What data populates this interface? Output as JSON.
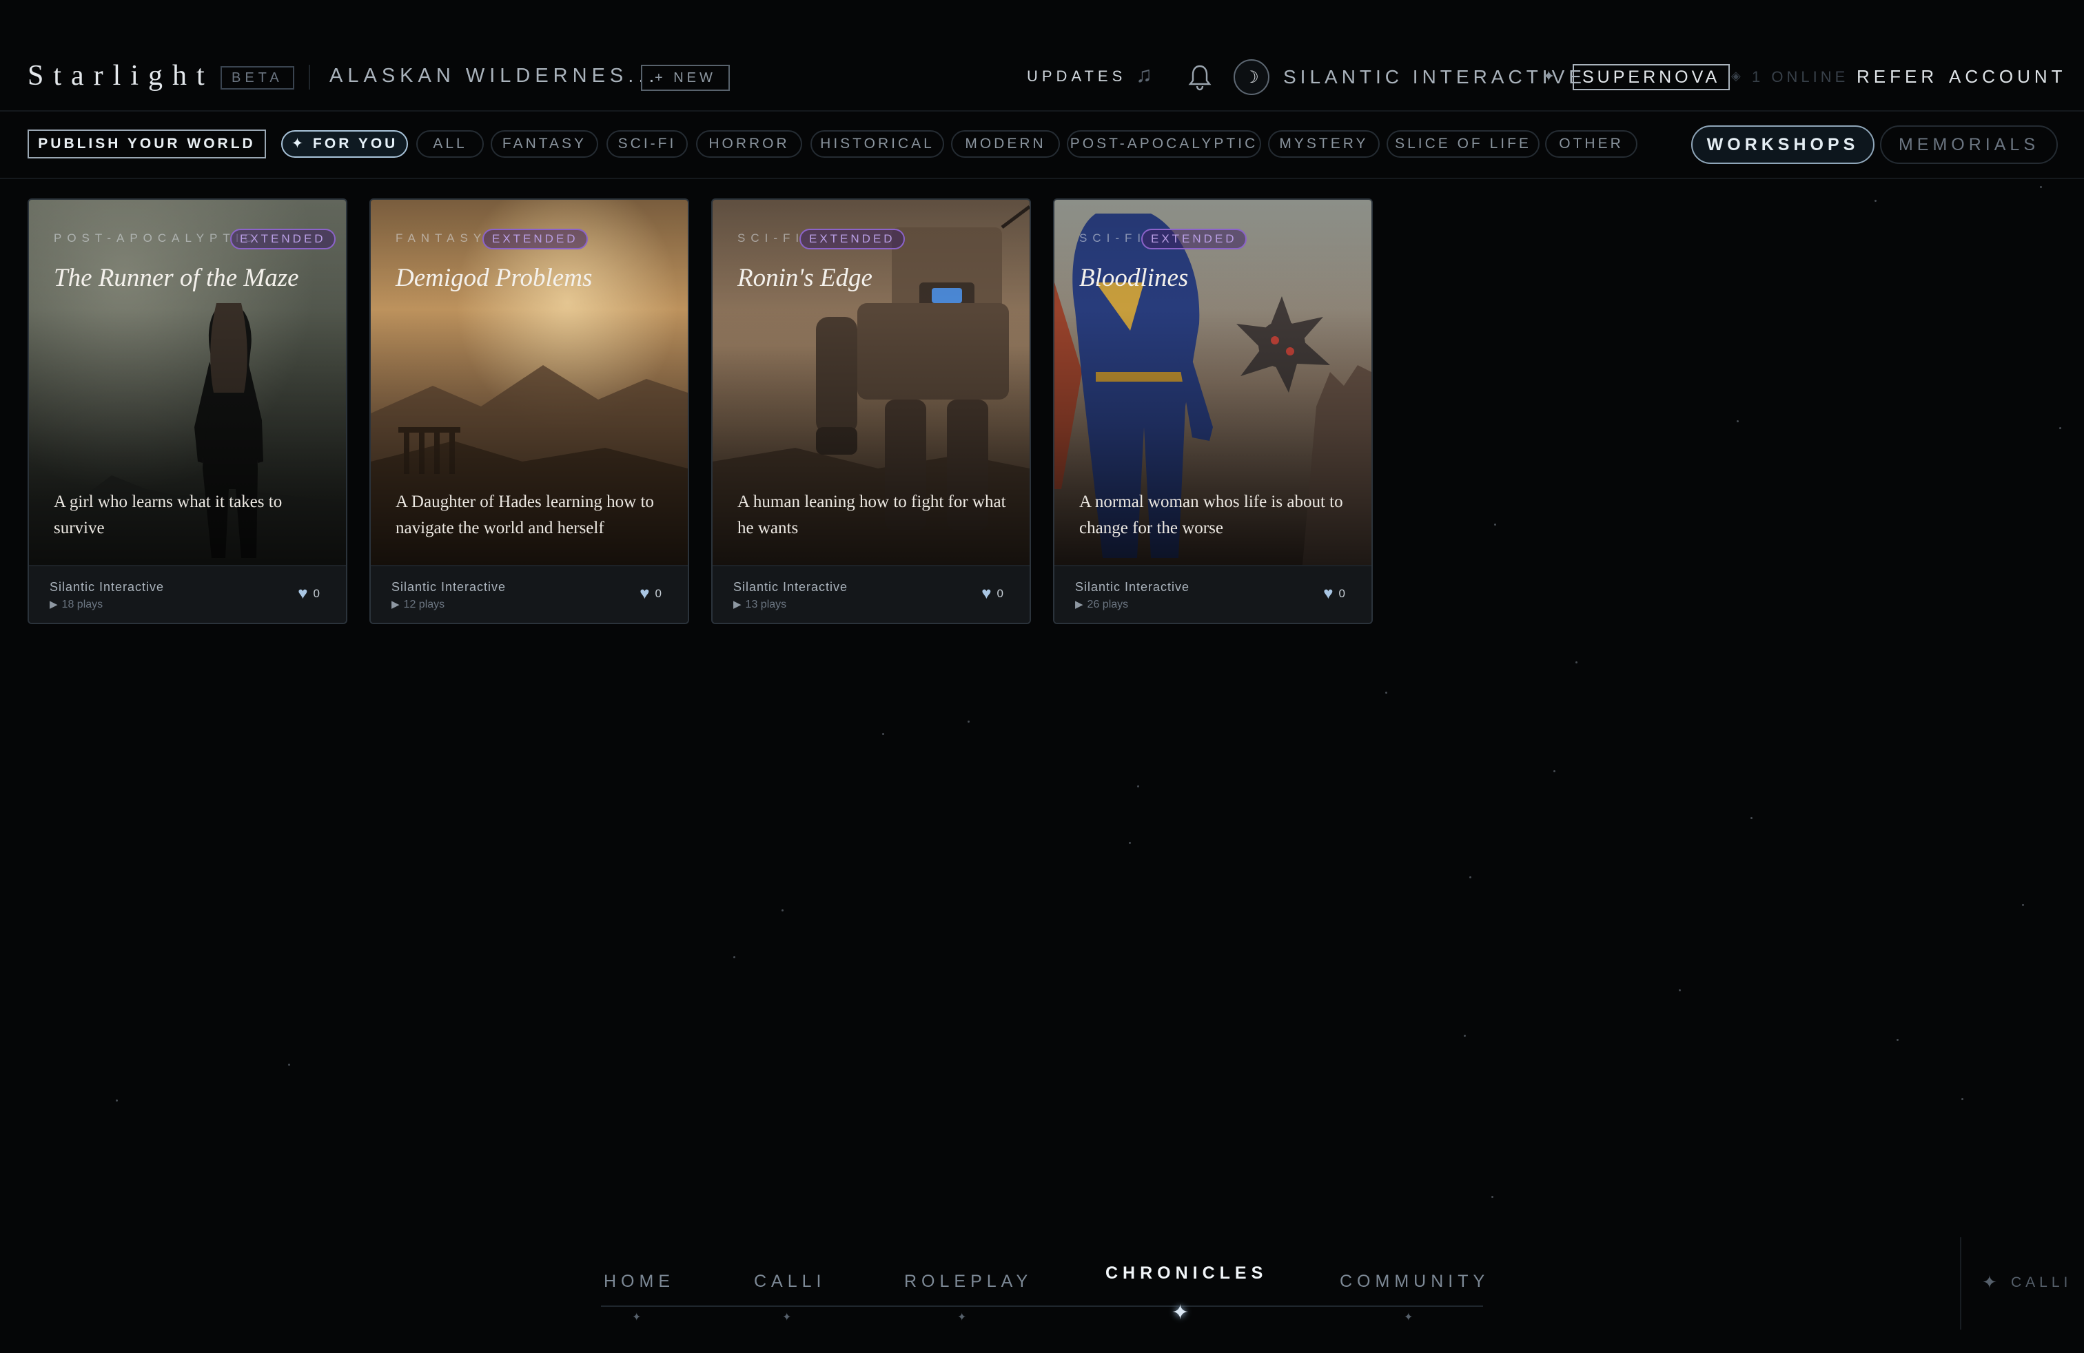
{
  "header": {
    "brand": "Starlight",
    "beta_badge": "BETA",
    "world_name": "ALASKAN WILDERNES...",
    "new_button": "+ NEW",
    "updates": "UPDATES",
    "music_icon": "music-note-icon",
    "bell_icon": "bell-icon",
    "avatar_glyph": "☽",
    "org_name": "SILANTIC INTERACTIVE",
    "org_spark": "✦",
    "plan": "SUPERNOVA",
    "online_dot": "◈",
    "online": "1 ONLINE",
    "refer": "REFER",
    "account": "ACCOUNT"
  },
  "filters": {
    "publish": "PUBLISH YOUR WORLD",
    "categories": [
      {
        "label": "✦ FOR YOU",
        "active": true
      },
      {
        "label": "ALL"
      },
      {
        "label": "FANTASY"
      },
      {
        "label": "SCI-FI"
      },
      {
        "label": "HORROR"
      },
      {
        "label": "HISTORICAL"
      },
      {
        "label": "MODERN"
      },
      {
        "label": "POST-APOCALYPTIC"
      },
      {
        "label": "MYSTERY"
      },
      {
        "label": "SLICE OF LIFE"
      },
      {
        "label": "OTHER"
      }
    ],
    "workshops": "WORKSHOPS",
    "memorials": "MEMORIALS"
  },
  "cards": [
    {
      "genre": "POST-APOCALYPTIC",
      "badge": "EXTENDED",
      "title": "The Runner of the Maze",
      "description": "A girl who learns what it takes to survive",
      "author": "Silantic Interactive",
      "plays": "18 plays",
      "likes": "0"
    },
    {
      "genre": "FANTASY",
      "badge": "EXTENDED",
      "title": "Demigod Problems",
      "description": "A Daughter of Hades learning how to navigate the world and herself",
      "author": "Silantic Interactive",
      "plays": "12 plays",
      "likes": "0"
    },
    {
      "genre": "SCI-FI",
      "badge": "EXTENDED",
      "title": "Ronin's Edge",
      "description": "A human leaning how to fight for what he wants",
      "author": "Silantic Interactive",
      "plays": "13 plays",
      "likes": "0"
    },
    {
      "genre": "SCI-FI",
      "badge": "EXTENDED",
      "title": "Bloodlines",
      "description": "A normal woman whos life is about to change for the worse",
      "author": "Silantic Interactive",
      "plays": "26 plays",
      "likes": "0"
    }
  ],
  "bottom_nav": [
    {
      "label": "HOME"
    },
    {
      "label": "CALLI"
    },
    {
      "label": "ROLEPLAY"
    },
    {
      "label": "CHRONICLES",
      "active": true
    },
    {
      "label": "COMMUNITY"
    }
  ],
  "calli_dock": {
    "spark": "✦",
    "label": "CALLI"
  },
  "colors": {
    "background": "#050607",
    "accent": "#a9c4da",
    "extended_badge": "#8b63c9"
  }
}
